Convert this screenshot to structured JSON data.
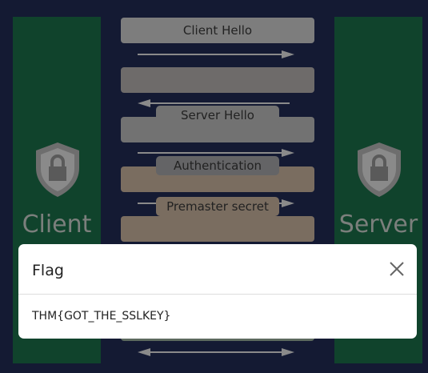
{
  "client_label": "Client",
  "server_label": "Server",
  "messages": {
    "client_hello": "Client Hello",
    "server_hello": "Server Hello",
    "authentication": "Authentication",
    "premaster": "Premaster secret"
  },
  "modal": {
    "title": "Flag",
    "body": "THM{GOT_THE_SSLKEY}"
  }
}
